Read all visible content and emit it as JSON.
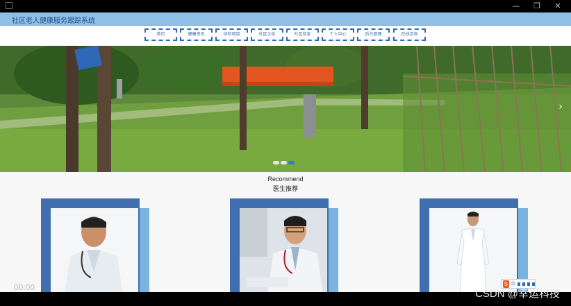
{
  "window": {
    "controls": {
      "minimize": "—",
      "maximize": "❐",
      "close": "✕"
    }
  },
  "site": {
    "title": "社区老人健康服务跟踪系统"
  },
  "nav": {
    "items": [
      {
        "label": "首页"
      },
      {
        "label": "健康资讯"
      },
      {
        "label": "体检项目"
      },
      {
        "label": "社区公告"
      },
      {
        "label": "社区信息"
      },
      {
        "label": "个人中心"
      },
      {
        "label": "后台管理"
      },
      {
        "label": "在线咨询"
      }
    ]
  },
  "banner": {
    "next_arrow": "›",
    "slides_count": 3,
    "active_slide": 3
  },
  "recommend": {
    "title_en": "Recommend",
    "title_zh": "医生推荐"
  },
  "player": {
    "time": "00:00",
    "watermark": "CSDN @幸运科技"
  },
  "ime": {
    "logo": "S",
    "mode": "中"
  },
  "colors": {
    "header_bg": "#8fbfe6",
    "nav_border": "#2e6ab0",
    "card_back": "#3f6fae",
    "card_accent": "#78b4df",
    "dot_active": "#2a7fc9"
  }
}
